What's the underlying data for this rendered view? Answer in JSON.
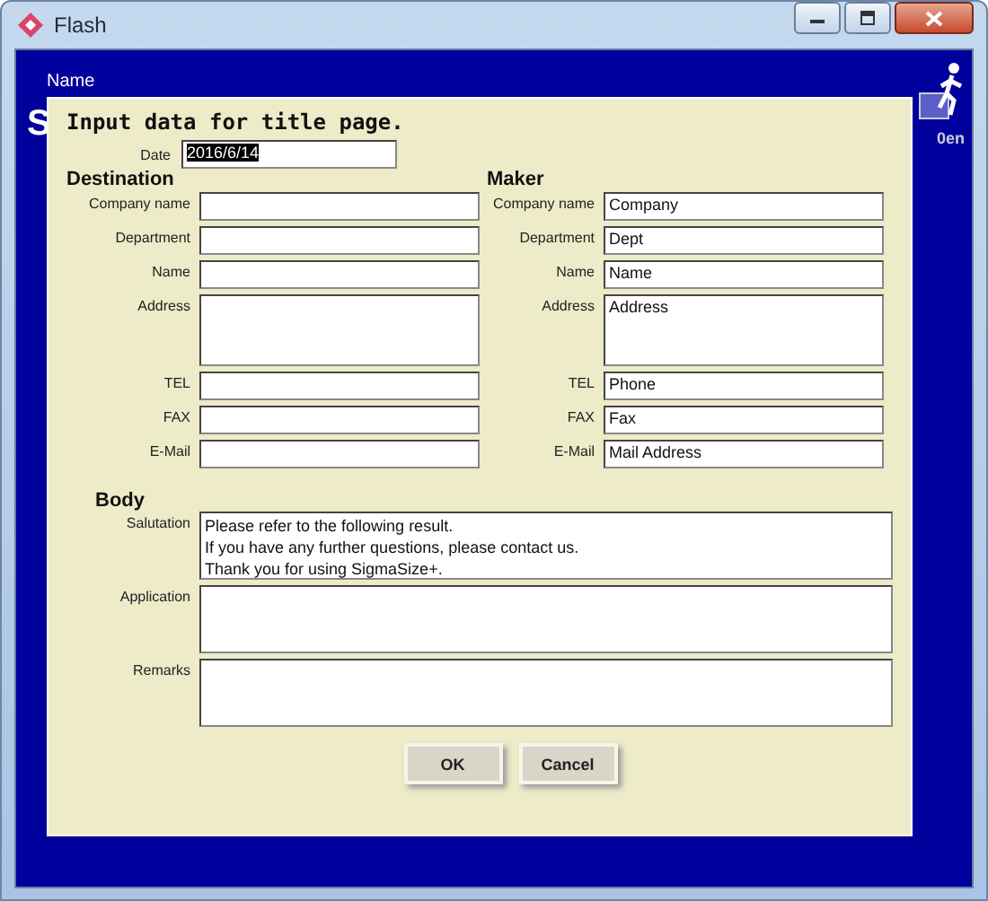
{
  "window": {
    "title": "Flash"
  },
  "background": {
    "name_label": "Name",
    "title_initial": "S",
    "version": "0en"
  },
  "dialog": {
    "title": "Input data for title page.",
    "date": {
      "label": "Date",
      "value": "2016/6/14",
      "selected": true
    },
    "destination": {
      "heading": "Destination",
      "fields": [
        {
          "label": "Company name",
          "kind": "line"
        },
        {
          "label": "Department",
          "kind": "line"
        },
        {
          "label": "Name",
          "kind": "line"
        },
        {
          "label": "Address",
          "kind": "area"
        },
        {
          "label": "TEL",
          "kind": "line"
        },
        {
          "label": "FAX",
          "kind": "line"
        },
        {
          "label": "E-Mail",
          "kind": "line"
        }
      ]
    },
    "maker": {
      "heading": "Maker",
      "fields": [
        {
          "label": "Company name",
          "kind": "line",
          "value": "Company"
        },
        {
          "label": "Department",
          "kind": "line",
          "value": "Dept"
        },
        {
          "label": "Name",
          "kind": "line",
          "value": "Name"
        },
        {
          "label": "Address",
          "kind": "area",
          "value": "Address"
        },
        {
          "label": "TEL",
          "kind": "line",
          "value": "Phone"
        },
        {
          "label": "FAX",
          "kind": "line",
          "value": "Fax"
        },
        {
          "label": "E-Mail",
          "kind": "line",
          "value": "Mail Address"
        }
      ]
    },
    "body": {
      "heading": "Body",
      "fields": [
        {
          "label": "Salutation",
          "value": "Please refer to the following result.\nIf you have any further questions, please contact us.\nThank you for using SigmaSize+."
        },
        {
          "label": "Application"
        },
        {
          "label": "Remarks"
        }
      ]
    },
    "buttons": [
      "OK",
      "Cancel"
    ]
  }
}
